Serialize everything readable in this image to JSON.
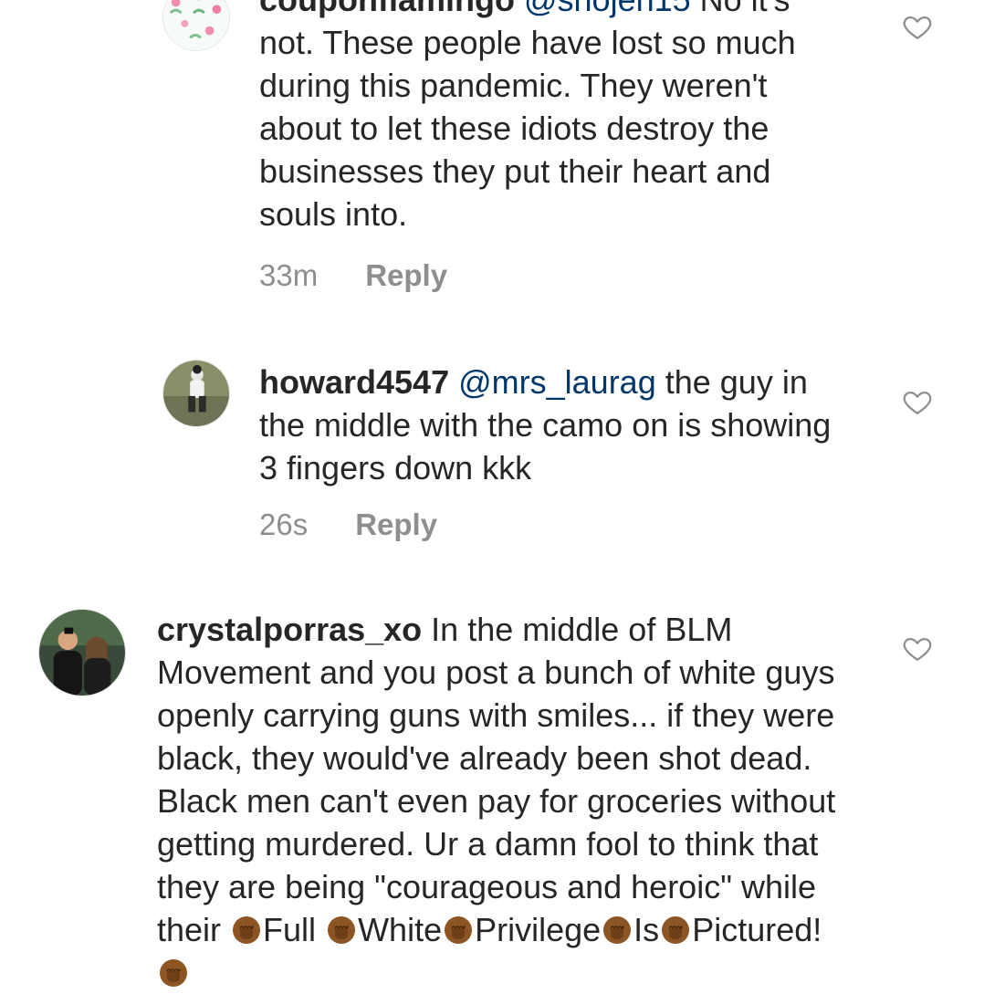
{
  "comments": [
    {
      "username": "couponflamingo",
      "mention": "@snojen15",
      "text": " No it's not. These people have lost so much during this pandemic. They weren't about to let these idiots destroy the businesses they put their heart and souls into.",
      "time": "33m",
      "reply_label": "Reply",
      "avatar_icon": "flamingo-pattern-avatar"
    },
    {
      "username": "howard4547",
      "mention": "@mrs_laurag",
      "text": " the guy in the middle with the camo on is showing 3 fingers down kkk",
      "time": "26s",
      "reply_label": "Reply",
      "avatar_icon": "person-photo-avatar"
    },
    {
      "username": "crystalporras_xo",
      "text_part1": " In the middle of BLM Movement and you post a bunch of white guys openly carrying guns with smiles... if they were black, they would've already been shot dead. Black men can't even pay for groceries without getting murdered. Ur a damn fool to think that they are being \"courageous and heroic\" while their ",
      "words": [
        "Full",
        "White",
        "Privilege",
        "Is",
        "Pictured!"
      ],
      "avatar_icon": "couple-photo-avatar"
    }
  ],
  "icons": {
    "like": "heart-outline-icon",
    "emoji": "raised-fist-emoji"
  },
  "colors": {
    "text": "#262626",
    "muted": "#8e8e8e",
    "mention": "#00376b",
    "heart": "#8e8e8e",
    "fist": "#8d5524"
  }
}
